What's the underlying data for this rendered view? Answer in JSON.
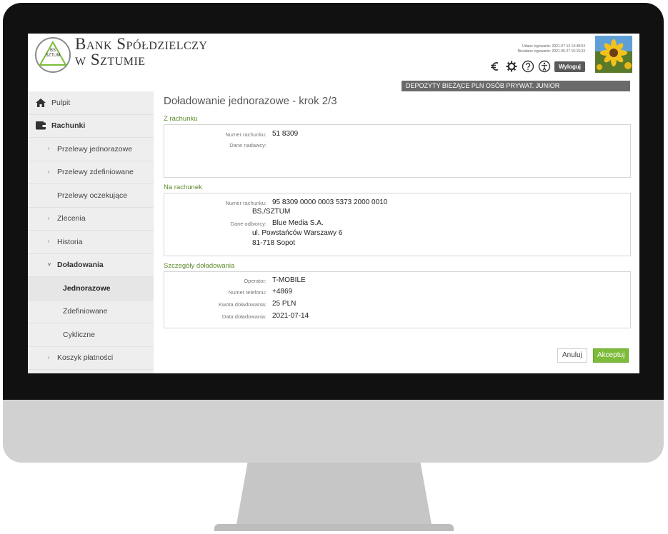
{
  "bank": {
    "name_line1": "Bank Spółdzielczy",
    "name_line2": "w Sztumie",
    "logo_text_line1": "BS",
    "logo_text_line2": "SZTUM"
  },
  "session": {
    "successful_login": "Udane logowanie: 2021-07-13 14:48:04",
    "failed_login": "Nieudane logowanie: 2021-05-27 15:15:33",
    "logout_label": "Wyloguj"
  },
  "header_icons": [
    "euro-icon",
    "settings-gear-icon",
    "help-icon",
    "accessibility-icon"
  ],
  "product_bar": "DEPOZYTY BIEŻĄCE PLN OSÓB PRYWAT. JUNIOR",
  "sidebar": {
    "items": [
      {
        "label": "Pulpit"
      },
      {
        "label": "Rachunki"
      },
      {
        "label": "Przelewy jednorazowe"
      },
      {
        "label": "Przelewy zdefiniowane"
      },
      {
        "label": "Przelewy oczekujące"
      },
      {
        "label": "Zlecenia"
      },
      {
        "label": "Historia"
      },
      {
        "label": "Doładowania"
      },
      {
        "label": "Jednorazowe"
      },
      {
        "label": "Zdefiniowane"
      },
      {
        "label": "Cykliczne"
      },
      {
        "label": "Koszyk płatności"
      }
    ]
  },
  "main": {
    "title": "Doładowanie jednorazowe - krok 2/3",
    "from_account": {
      "section_label": "Z rachunku",
      "account_number_label": "Numer rachunku:",
      "account_number": "51 8309",
      "sender_label": "Dane nadawcy:",
      "sender": ""
    },
    "to_account": {
      "section_label": "Na rachunek",
      "account_number_label": "Numer rachunku:",
      "account_number": "95 8309 0000 0003 5373 2000 0010",
      "bank_name": "BS./SZTUM",
      "recipient_label": "Dane odbiorcy:",
      "recipient_line1": "Blue Media S.A.",
      "recipient_line2": "ul. Powstańców Warszawy 6",
      "recipient_line3": "81-718 Sopot"
    },
    "details": {
      "section_label": "Szczegóły doładowania",
      "operator_label": "Operator:",
      "operator": "T-MOBILE",
      "phone_label": "Numer telefonu:",
      "phone": "+4869",
      "amount_label": "Kwota doładowania:",
      "amount": "25 PLN",
      "date_label": "Data doładowania:",
      "date": "2021-07-14"
    },
    "buttons": {
      "cancel": "Anuluj",
      "accept": "Akceptuj"
    }
  },
  "colors": {
    "accent_green": "#7dbb3a",
    "section_green": "#5c8a2c",
    "product_bar": "#6a6a6a",
    "sidebar_bg": "#eeeeee"
  }
}
